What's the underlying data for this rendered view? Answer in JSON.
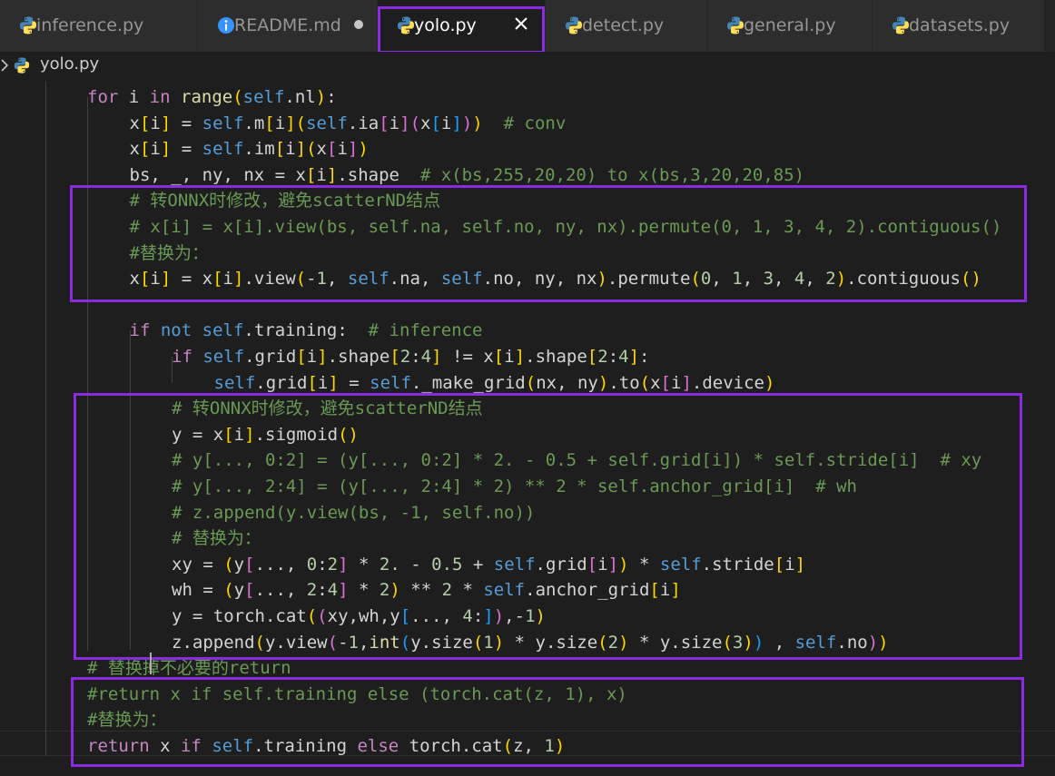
{
  "tabs": [
    {
      "label": "inference.py",
      "icon": "python-icon",
      "active": false
    },
    {
      "label": "README.md",
      "icon": "info-icon",
      "active": false,
      "modified": true
    },
    {
      "label": "yolo.py",
      "icon": "python-icon",
      "active": true
    },
    {
      "label": "detect.py",
      "icon": "python-icon",
      "active": false
    },
    {
      "label": "general.py",
      "icon": "python-icon",
      "active": false
    },
    {
      "label": "datasets.py",
      "icon": "python-icon",
      "active": false
    }
  ],
  "breadcrumb": {
    "file": "yolo.py"
  },
  "colors": {
    "highlight": "#8a2be2",
    "keyword": "#569cd6",
    "control": "#c586c0",
    "function": "#dcdcaa",
    "comment": "#6a9955",
    "number": "#b5cea8",
    "bracket_gold": "#ffd700",
    "bracket_orchid": "#da70d6",
    "bracket_blue": "#179fff"
  },
  "code_lines": [
    {
      "indent": 2,
      "tokens": [
        [
          "kwc",
          "for"
        ],
        [
          "op",
          " i "
        ],
        [
          "kwc",
          "in"
        ],
        [
          "op",
          " "
        ],
        [
          "fn",
          "range"
        ],
        [
          "b1",
          "("
        ],
        [
          "self",
          "self"
        ],
        [
          "op",
          ".nl"
        ],
        [
          "b1",
          ")"
        ],
        [
          "op",
          ":"
        ]
      ]
    },
    {
      "indent": 3,
      "tokens": [
        [
          "op",
          "x"
        ],
        [
          "b1",
          "["
        ],
        [
          "op",
          "i"
        ],
        [
          "b1",
          "]"
        ],
        [
          "op",
          " = "
        ],
        [
          "self",
          "self"
        ],
        [
          "op",
          ".m"
        ],
        [
          "b1",
          "["
        ],
        [
          "op",
          "i"
        ],
        [
          "b1",
          "]"
        ],
        [
          "b1",
          "("
        ],
        [
          "self",
          "self"
        ],
        [
          "op",
          ".ia"
        ],
        [
          "b2",
          "["
        ],
        [
          "op",
          "i"
        ],
        [
          "b2",
          "]"
        ],
        [
          "b2",
          "("
        ],
        [
          "op",
          "x"
        ],
        [
          "b3",
          "["
        ],
        [
          "op",
          "i"
        ],
        [
          "b3",
          "]"
        ],
        [
          "b2",
          ")"
        ],
        [
          "b1",
          ")"
        ],
        [
          "op",
          "  "
        ],
        [
          "cm",
          "# conv"
        ]
      ]
    },
    {
      "indent": 3,
      "tokens": [
        [
          "op",
          "x"
        ],
        [
          "b1",
          "["
        ],
        [
          "op",
          "i"
        ],
        [
          "b1",
          "]"
        ],
        [
          "op",
          " = "
        ],
        [
          "self",
          "self"
        ],
        [
          "op",
          ".im"
        ],
        [
          "b1",
          "["
        ],
        [
          "op",
          "i"
        ],
        [
          "b1",
          "]"
        ],
        [
          "b1",
          "("
        ],
        [
          "op",
          "x"
        ],
        [
          "b2",
          "["
        ],
        [
          "op",
          "i"
        ],
        [
          "b2",
          "]"
        ],
        [
          "b1",
          ")"
        ]
      ]
    },
    {
      "indent": 3,
      "tokens": [
        [
          "op",
          "bs, _, ny, nx = x"
        ],
        [
          "b1",
          "["
        ],
        [
          "op",
          "i"
        ],
        [
          "b1",
          "]"
        ],
        [
          "op",
          ".shape  "
        ],
        [
          "cm",
          "# x(bs,255,20,20) to x(bs,3,20,20,85)"
        ]
      ]
    },
    {
      "indent": 3,
      "tokens": [
        [
          "cm",
          "# 转ONNX时修改，避免scatterND结点"
        ]
      ]
    },
    {
      "indent": 3,
      "tokens": [
        [
          "cm",
          "# x[i] = x[i].view(bs, self.na, self.no, ny, nx).permute(0, 1, 3, 4, 2).contiguous()"
        ]
      ]
    },
    {
      "indent": 3,
      "tokens": [
        [
          "cm",
          "#替换为："
        ]
      ]
    },
    {
      "indent": 3,
      "tokens": [
        [
          "op",
          "x"
        ],
        [
          "b1",
          "["
        ],
        [
          "op",
          "i"
        ],
        [
          "b1",
          "]"
        ],
        [
          "op",
          " = x"
        ],
        [
          "b1",
          "["
        ],
        [
          "op",
          "i"
        ],
        [
          "b1",
          "]"
        ],
        [
          "op",
          ".view"
        ],
        [
          "b1",
          "("
        ],
        [
          "op",
          "-"
        ],
        [
          "nm",
          "1"
        ],
        [
          "op",
          ", "
        ],
        [
          "self",
          "self"
        ],
        [
          "op",
          ".na, "
        ],
        [
          "self",
          "self"
        ],
        [
          "op",
          ".no, ny, nx"
        ],
        [
          "b1",
          ")"
        ],
        [
          "op",
          ".permute"
        ],
        [
          "b1",
          "("
        ],
        [
          "nm",
          "0"
        ],
        [
          "op",
          ", "
        ],
        [
          "nm",
          "1"
        ],
        [
          "op",
          ", "
        ],
        [
          "nm",
          "3"
        ],
        [
          "op",
          ", "
        ],
        [
          "nm",
          "4"
        ],
        [
          "op",
          ", "
        ],
        [
          "nm",
          "2"
        ],
        [
          "b1",
          ")"
        ],
        [
          "op",
          ".contiguous"
        ],
        [
          "b1",
          "()"
        ]
      ]
    },
    {
      "indent": 0,
      "tokens": []
    },
    {
      "indent": 3,
      "tokens": [
        [
          "kwc",
          "if"
        ],
        [
          "op",
          " "
        ],
        [
          "kw",
          "not"
        ],
        [
          "op",
          " "
        ],
        [
          "self",
          "self"
        ],
        [
          "op",
          ".training:  "
        ],
        [
          "cm",
          "# inference"
        ]
      ]
    },
    {
      "indent": 4,
      "tokens": [
        [
          "kwc",
          "if"
        ],
        [
          "op",
          " "
        ],
        [
          "self",
          "self"
        ],
        [
          "op",
          ".grid"
        ],
        [
          "b1",
          "["
        ],
        [
          "op",
          "i"
        ],
        [
          "b1",
          "]"
        ],
        [
          "op",
          ".shape"
        ],
        [
          "b1",
          "["
        ],
        [
          "nm",
          "2"
        ],
        [
          "op",
          ":"
        ],
        [
          "nm",
          "4"
        ],
        [
          "b1",
          "]"
        ],
        [
          "op",
          " != x"
        ],
        [
          "b1",
          "["
        ],
        [
          "op",
          "i"
        ],
        [
          "b1",
          "]"
        ],
        [
          "op",
          ".shape"
        ],
        [
          "b1",
          "["
        ],
        [
          "nm",
          "2"
        ],
        [
          "op",
          ":"
        ],
        [
          "nm",
          "4"
        ],
        [
          "b1",
          "]"
        ],
        [
          "op",
          ":"
        ]
      ]
    },
    {
      "indent": 5,
      "tokens": [
        [
          "self",
          "self"
        ],
        [
          "op",
          ".grid"
        ],
        [
          "b1",
          "["
        ],
        [
          "op",
          "i"
        ],
        [
          "b1",
          "]"
        ],
        [
          "op",
          " = "
        ],
        [
          "self",
          "self"
        ],
        [
          "op",
          "._make_grid"
        ],
        [
          "b1",
          "("
        ],
        [
          "op",
          "nx, ny"
        ],
        [
          "b1",
          ")"
        ],
        [
          "op",
          ".to"
        ],
        [
          "b1",
          "("
        ],
        [
          "op",
          "x"
        ],
        [
          "b2",
          "["
        ],
        [
          "op",
          "i"
        ],
        [
          "b2",
          "]"
        ],
        [
          "op",
          ".device"
        ],
        [
          "b1",
          ")"
        ]
      ]
    },
    {
      "indent": 4,
      "tokens": [
        [
          "cm",
          "# 转ONNX时修改，避免scatterND结点"
        ]
      ]
    },
    {
      "indent": 4,
      "tokens": [
        [
          "op",
          "y = x"
        ],
        [
          "b1",
          "["
        ],
        [
          "op",
          "i"
        ],
        [
          "b1",
          "]"
        ],
        [
          "op",
          ".sigmoid"
        ],
        [
          "b1",
          "()"
        ]
      ]
    },
    {
      "indent": 4,
      "tokens": [
        [
          "cm",
          "# y[..., 0:2] = (y[..., 0:2] * 2. - 0.5 + self.grid[i]) * self.stride[i]  # xy"
        ]
      ]
    },
    {
      "indent": 4,
      "tokens": [
        [
          "cm",
          "# y[..., 2:4] = (y[..., 2:4] * 2) ** 2 * self.anchor_grid[i]  # wh"
        ]
      ]
    },
    {
      "indent": 4,
      "tokens": [
        [
          "cm",
          "# z.append(y.view(bs, -1, self.no))"
        ]
      ]
    },
    {
      "indent": 4,
      "tokens": [
        [
          "cm",
          "# 替换为："
        ]
      ]
    },
    {
      "indent": 4,
      "tokens": [
        [
          "op",
          "xy = "
        ],
        [
          "b1",
          "("
        ],
        [
          "op",
          "y"
        ],
        [
          "b2",
          "["
        ],
        [
          "op",
          "..., "
        ],
        [
          "nm",
          "0"
        ],
        [
          "op",
          ":"
        ],
        [
          "nm",
          "2"
        ],
        [
          "b2",
          "]"
        ],
        [
          "op",
          " * "
        ],
        [
          "nm",
          "2."
        ],
        [
          "op",
          " - "
        ],
        [
          "nm",
          "0.5"
        ],
        [
          "op",
          " + "
        ],
        [
          "self",
          "self"
        ],
        [
          "op",
          ".grid"
        ],
        [
          "b2",
          "["
        ],
        [
          "op",
          "i"
        ],
        [
          "b2",
          "]"
        ],
        [
          "b1",
          ")"
        ],
        [
          "op",
          " * "
        ],
        [
          "self",
          "self"
        ],
        [
          "op",
          ".stride"
        ],
        [
          "b1",
          "["
        ],
        [
          "op",
          "i"
        ],
        [
          "b1",
          "]"
        ]
      ]
    },
    {
      "indent": 4,
      "tokens": [
        [
          "op",
          "wh = "
        ],
        [
          "b1",
          "("
        ],
        [
          "op",
          "y"
        ],
        [
          "b2",
          "["
        ],
        [
          "op",
          "..., "
        ],
        [
          "nm",
          "2"
        ],
        [
          "op",
          ":"
        ],
        [
          "nm",
          "4"
        ],
        [
          "b2",
          "]"
        ],
        [
          "op",
          " * "
        ],
        [
          "nm",
          "2"
        ],
        [
          "b1",
          ")"
        ],
        [
          "op",
          " ** "
        ],
        [
          "nm",
          "2"
        ],
        [
          "op",
          " * "
        ],
        [
          "self",
          "self"
        ],
        [
          "op",
          ".anchor_grid"
        ],
        [
          "b1",
          "["
        ],
        [
          "op",
          "i"
        ],
        [
          "b1",
          "]"
        ]
      ]
    },
    {
      "indent": 4,
      "tokens": [
        [
          "op",
          "y = torch.cat"
        ],
        [
          "b1",
          "("
        ],
        [
          "b2",
          "("
        ],
        [
          "op",
          "xy,wh,y"
        ],
        [
          "b3",
          "["
        ],
        [
          "op",
          "..., "
        ],
        [
          "nm",
          "4"
        ],
        [
          "op",
          ":"
        ],
        [
          "b3",
          "]"
        ],
        [
          "b2",
          ")"
        ],
        [
          "op",
          ",-"
        ],
        [
          "nm",
          "1"
        ],
        [
          "b1",
          ")"
        ]
      ]
    },
    {
      "indent": 4,
      "tokens": [
        [
          "op",
          "z.append"
        ],
        [
          "b1",
          "("
        ],
        [
          "op",
          "y.view"
        ],
        [
          "b2",
          "("
        ],
        [
          "op",
          "-"
        ],
        [
          "nm",
          "1"
        ],
        [
          "op",
          ","
        ],
        [
          "fn",
          "int"
        ],
        [
          "b3",
          "("
        ],
        [
          "op",
          "y.size"
        ],
        [
          "b1",
          "("
        ],
        [
          "nm",
          "1"
        ],
        [
          "b1",
          ")"
        ],
        [
          "op",
          " * y.size"
        ],
        [
          "b1",
          "("
        ],
        [
          "nm",
          "2"
        ],
        [
          "b1",
          ")"
        ],
        [
          "op",
          " * y.size"
        ],
        [
          "b1",
          "("
        ],
        [
          "nm",
          "3"
        ],
        [
          "b1",
          ")"
        ],
        [
          "b3",
          ")"
        ],
        [
          "op",
          " , "
        ],
        [
          "self",
          "self"
        ],
        [
          "op",
          ".no"
        ],
        [
          "b2",
          ")"
        ],
        [
          "b1",
          ")"
        ]
      ]
    },
    {
      "indent": 2,
      "tokens": [
        [
          "cm",
          "# 替换掉不必要的return"
        ]
      ]
    },
    {
      "indent": 2,
      "tokens": [
        [
          "cm",
          "#return x if self.training else (torch.cat(z, 1), x)"
        ]
      ]
    },
    {
      "indent": 2,
      "tokens": [
        [
          "cm",
          "#替换为："
        ]
      ]
    },
    {
      "indent": 2,
      "tokens": [
        [
          "kwc",
          "return"
        ],
        [
          "op",
          " x "
        ],
        [
          "kwc",
          "if"
        ],
        [
          "op",
          " "
        ],
        [
          "self",
          "self"
        ],
        [
          "op",
          ".training "
        ],
        [
          "kwc",
          "else"
        ],
        [
          "op",
          " torch.cat"
        ],
        [
          "b1",
          "("
        ],
        [
          "op",
          "z, "
        ],
        [
          "nm",
          "1"
        ],
        [
          "b1",
          ")"
        ]
      ]
    }
  ]
}
